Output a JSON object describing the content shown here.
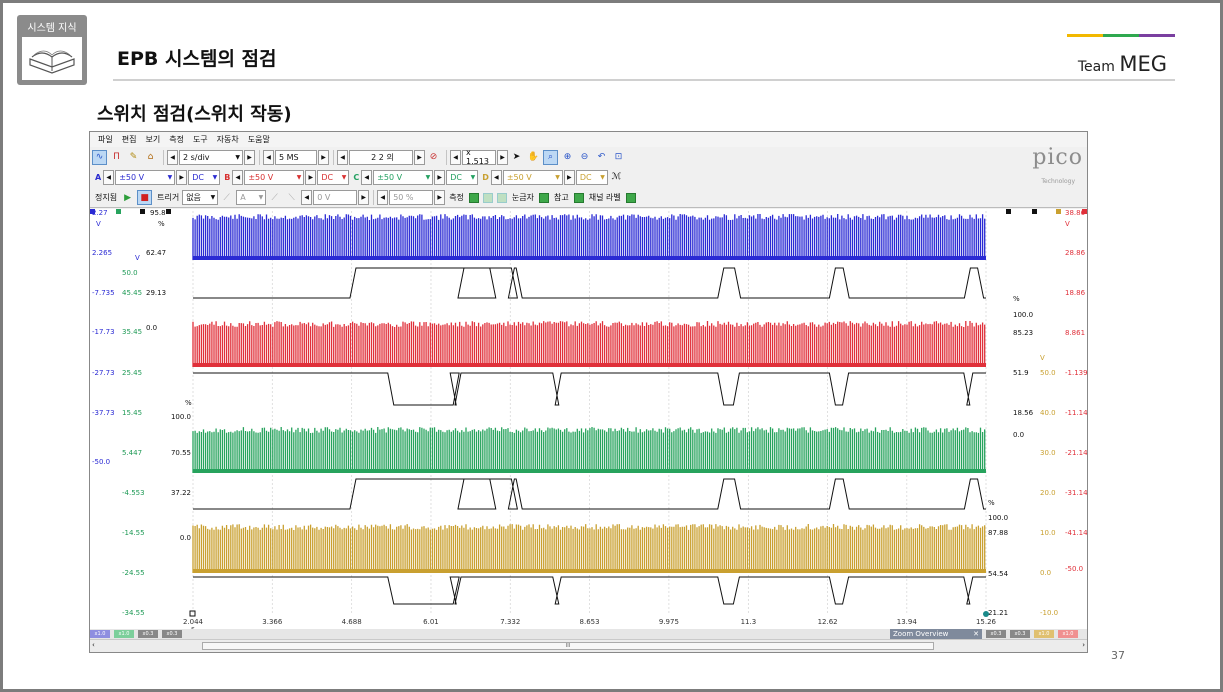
{
  "slide": {
    "badge": "시스템 지식",
    "title": "EPB 시스템의 점검",
    "team_prefix": "Team",
    "team_name": "MEG",
    "subtitle": "스위치 점검(스위치 작동)",
    "page_number": "37",
    "accent_colors": [
      "#f2b800",
      "#2fa84f",
      "#7a3fa0"
    ]
  },
  "app": {
    "menu": [
      "파일",
      "편집",
      "보기",
      "측정",
      "도구",
      "자동차",
      "도움말"
    ],
    "timebase": "2 s/div",
    "samples": "5 MS",
    "capture_count": "2 2 의",
    "zoom": "x 1.513",
    "channels": [
      {
        "label": "A",
        "range": "±50 V",
        "coupling": "DC",
        "color": "#2b2bd0"
      },
      {
        "label": "B",
        "range": "±50 V",
        "coupling": "DC",
        "color": "#d83030"
      },
      {
        "label": "C",
        "range": "±50 V",
        "coupling": "DC",
        "color": "#22a060"
      },
      {
        "label": "D",
        "range": "±50 V",
        "coupling": "DC",
        "color": "#c8a030"
      }
    ],
    "toolbar3": {
      "stop": "정지됨",
      "trigger": "트리거",
      "trigger_mode": "없음",
      "trig_channel": "A",
      "trig_level": "0 V",
      "trig_pct": "50 %",
      "measure": "측정",
      "ruler": "눈금자",
      "reference": "참고",
      "channel_label": "채널 라벨"
    },
    "brand": "pico",
    "brand_sub": "Technology",
    "zoom_overview": "Zoom Overview",
    "x_unit": "s",
    "scale_tags": [
      "x1.0",
      "x1.0",
      "x0.3",
      "x0.3",
      "x0.3",
      "x0.3",
      "x1.0",
      "x1.0"
    ],
    "scroll_thumb_glyph": "III"
  },
  "chart_data": {
    "type": "line",
    "xlabel": "s",
    "x_ticks": [
      "2.044",
      "3.366",
      "4.688",
      "6.01",
      "7.332",
      "8.653",
      "9.975",
      "11.3",
      "12.62",
      "13.94",
      "15.26"
    ],
    "left_axis_blue": {
      "unit": "V",
      "labels": [
        "2.265",
        "-7.735",
        "-17.73",
        "-27.73",
        "-37.73",
        "-50.0"
      ],
      "top": "2.27"
    },
    "left_axis_green": {
      "unit": "V",
      "labels": [
        "50.0",
        "45.45",
        "35.45",
        "25.45",
        "15.45",
        "5.447",
        "-4.553",
        "-14.55",
        "-24.55",
        "-34.55"
      ]
    },
    "left_pct_axis": {
      "unit": "%",
      "top": "95.8",
      "labels": [
        "62.47",
        "29.13",
        "0.0"
      ]
    },
    "inner_pct_axes": [
      {
        "unit": "%",
        "labels": [
          "100.0",
          "70.55",
          "37.22",
          "0.0"
        ]
      }
    ],
    "right_pct_axes": [
      {
        "unit": "%",
        "labels": [
          "100.0",
          "85.23",
          "51.9",
          "18.56",
          "0.0"
        ]
      },
      {
        "unit": "%",
        "labels": [
          "100.0",
          "87.88",
          "54.54",
          "21.21"
        ]
      }
    ],
    "right_axis_gold": {
      "unit": "V",
      "labels": [
        "50.0",
        "40.0",
        "30.0",
        "20.0",
        "10.0",
        "0.0",
        "-10.0"
      ]
    },
    "right_axis_red": {
      "unit": "V",
      "top": "38.86",
      "labels": [
        "28.86",
        "18.86",
        "8.861",
        "-1.139",
        "-11.14",
        "-21.14",
        "-31.14",
        "-41.14",
        "-50.0"
      ]
    },
    "series": [
      {
        "channel": "A",
        "color": "#2a2ad4",
        "kind": "pwm_band"
      },
      {
        "channel": "A duty",
        "color": "#111111",
        "kind": "duty",
        "high_intervals_s": [
          [
            4.71,
            7.04
          ],
          [
            6.51,
            7.4
          ],
          [
            7.35,
            7.48
          ],
          [
            10.84,
            11.12
          ],
          [
            12.7,
            12.93
          ],
          [
            14.95,
            15.17
          ]
        ]
      },
      {
        "channel": "B",
        "color": "#e0303a",
        "kind": "pwm_band"
      },
      {
        "channel": "B duty",
        "color": "#111111",
        "kind": "duty_inverse",
        "low_intervals_s": [
          [
            5.34,
            6.43
          ],
          [
            6.38,
            6.46
          ],
          [
            8.09,
            8.13
          ],
          [
            10.84,
            11.1
          ],
          [
            12.7,
            12.92
          ],
          [
            14.94,
            14.99
          ]
        ]
      },
      {
        "channel": "C",
        "color": "#27a35d",
        "kind": "pwm_band"
      },
      {
        "channel": "C duty",
        "color": "#111111",
        "kind": "duty"
      },
      {
        "channel": "D",
        "color": "#c9a030",
        "kind": "pwm_band"
      },
      {
        "channel": "D duty",
        "color": "#111111",
        "kind": "duty_inverse"
      }
    ]
  }
}
